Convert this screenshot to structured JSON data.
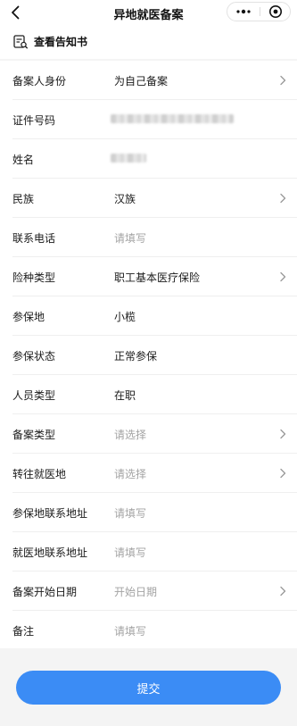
{
  "nav": {
    "title": "异地就医备案",
    "back_icon": "chevron-left-icon",
    "more_icon": "more-dots-icon",
    "target_icon": "target-circle-icon"
  },
  "notice": {
    "icon": "document-search-icon",
    "label": "查看告知书"
  },
  "form": {
    "rows": [
      {
        "label": "备案人身份",
        "value": "为自己备案",
        "placeholder": false,
        "arrow": true
      },
      {
        "label": "证件号码",
        "value": "",
        "masked": true
      },
      {
        "label": "姓名",
        "value": "",
        "masked": true
      },
      {
        "label": "民族",
        "value": "汉族",
        "placeholder": false,
        "arrow": true
      },
      {
        "label": "联系电话",
        "value": "请填写",
        "placeholder": true,
        "arrow": false
      },
      {
        "label": "险种类型",
        "value": "职工基本医疗保险",
        "placeholder": false,
        "arrow": true
      },
      {
        "label": "参保地",
        "value": "小榄",
        "placeholder": false,
        "arrow": false
      },
      {
        "label": "参保状态",
        "value": "正常参保",
        "placeholder": false,
        "arrow": false
      },
      {
        "label": "人员类型",
        "value": "在职",
        "placeholder": false,
        "arrow": false
      },
      {
        "label": "备案类型",
        "value": "请选择",
        "placeholder": true,
        "arrow": true
      },
      {
        "label": "转往就医地",
        "value": "请选择",
        "placeholder": true,
        "arrow": true
      },
      {
        "label": "参保地联系地址",
        "value": "请填写",
        "placeholder": true,
        "arrow": false
      },
      {
        "label": "就医地联系地址",
        "value": "请填写",
        "placeholder": true,
        "arrow": false
      },
      {
        "label": "备案开始日期",
        "value": "开始日期",
        "placeholder": true,
        "arrow": true
      },
      {
        "label": "备注",
        "value": "请填写",
        "placeholder": true,
        "arrow": false
      }
    ]
  },
  "footer": {
    "submit_label": "提交"
  },
  "colors": {
    "accent": "#3b8cf5",
    "background": "#f4f4f4",
    "placeholder": "#a3a3a3"
  }
}
